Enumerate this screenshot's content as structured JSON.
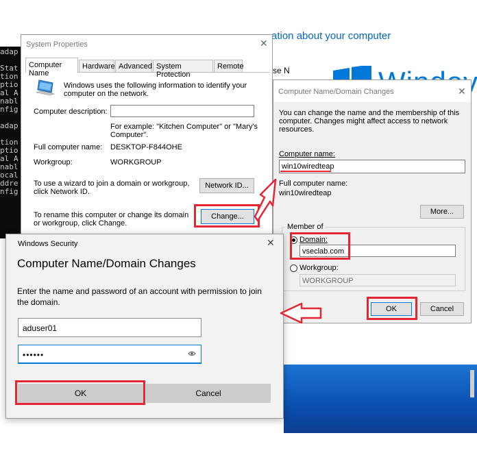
{
  "background": {
    "about_text": "ation about your computer",
    "side_text": "se N",
    "windows_logo_text": "Windov",
    "cmd_lines": [
      "adap",
      "",
      "Stat",
      "tion",
      "ptio",
      "al A",
      "nabl",
      "nfig",
      "",
      "adap",
      "",
      "tion",
      "ptio",
      "al A",
      "nabl",
      "ocal",
      "ddre",
      "nfig"
    ]
  },
  "system_properties": {
    "title": "System Properties",
    "tabs": [
      "Computer Name",
      "Hardware",
      "Advanced",
      "System Protection",
      "Remote"
    ],
    "active_tab": "Computer Name",
    "intro": "Windows uses the following information to identify your computer on the network.",
    "description_label": "Computer description:",
    "description_value": "",
    "example_text": "For example: \"Kitchen Computer\" or \"Mary's Computer\".",
    "full_name_label": "Full computer name:",
    "full_name_value": "DESKTOP-F844OHE",
    "workgroup_label": "Workgroup:",
    "workgroup_value": "WORKGROUP",
    "wizard_text": "To use a wizard to join a domain or workgroup, click Network ID.",
    "network_id_button": "Network ID...",
    "rename_text": "To rename this computer or change its domain or workgroup, click Change.",
    "change_button": "Change..."
  },
  "name_changes": {
    "title": "Computer Name/Domain Changes",
    "intro": "You can change the name and the membership of this computer. Changes might affect access to network resources.",
    "computer_name_label": "Computer name:",
    "computer_name_value": "win10wiredteap",
    "full_name_label": "Full computer name:",
    "full_name_value": "win10wiredteap",
    "more_button": "More...",
    "member_of_label": "Member of",
    "domain_label": "Domain:",
    "domain_value": "vseclab.com",
    "workgroup_label": "Workgroup:",
    "workgroup_value": "WORKGROUP",
    "ok_button": "OK",
    "cancel_button": "Cancel"
  },
  "windows_security": {
    "title": "Windows Security",
    "heading": "Computer Name/Domain Changes",
    "prompt": "Enter the name and password of an account with permission to join the domain.",
    "username_value": "aduser01",
    "password_value": "••••••",
    "ok_button": "OK",
    "cancel_button": "Cancel"
  },
  "colors": {
    "highlight": "#e52531",
    "win_blue": "#0078d7",
    "link_blue": "#0066cc",
    "dialog_bg": "#f0f0f0"
  }
}
